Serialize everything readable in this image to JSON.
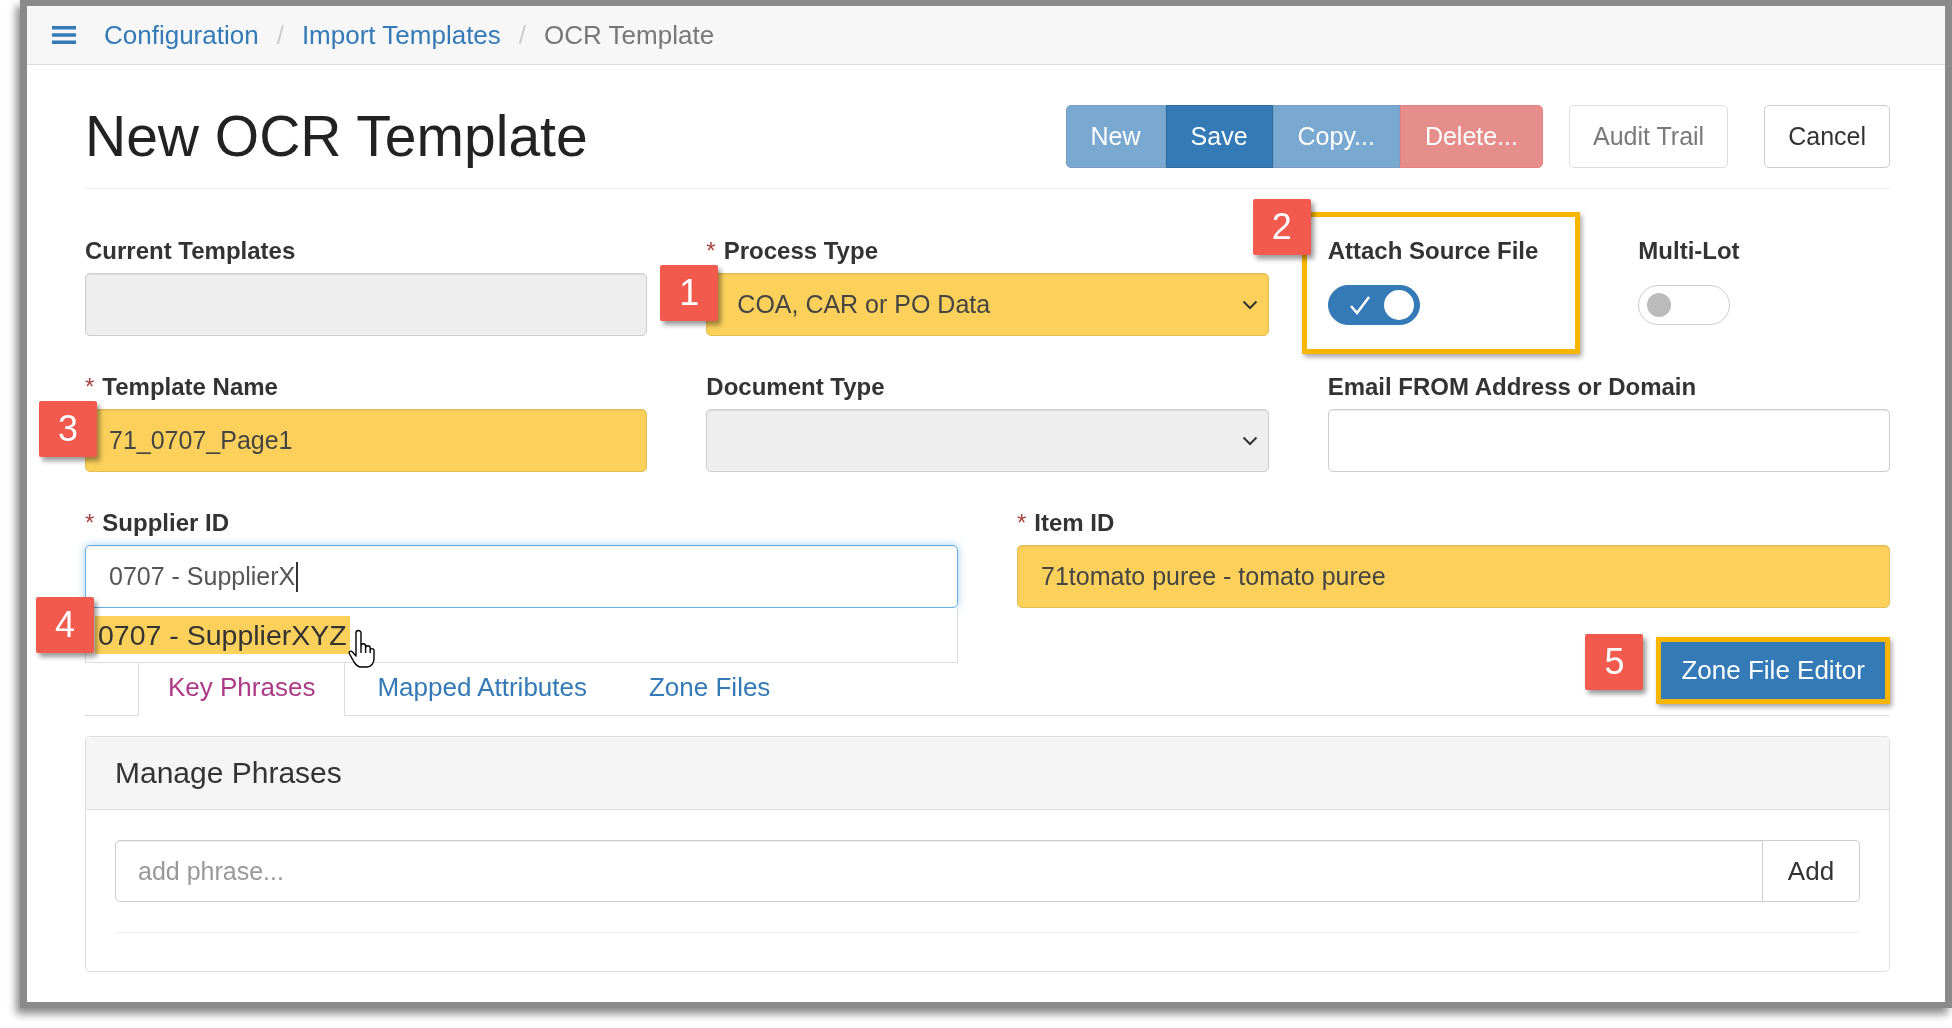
{
  "breadcrumb": {
    "separator": "/",
    "items": [
      {
        "label": "Configuration",
        "current": false
      },
      {
        "label": "Import Templates",
        "current": false
      },
      {
        "label": "OCR Template",
        "current": true
      }
    ]
  },
  "title": "New OCR Template",
  "actions": {
    "group": [
      {
        "label": "New",
        "kind": "primary",
        "disabled": true
      },
      {
        "label": "Save",
        "kind": "primary",
        "disabled": false
      },
      {
        "label": "Copy...",
        "kind": "primary",
        "disabled": true
      },
      {
        "label": "Delete...",
        "kind": "danger",
        "disabled": true
      }
    ],
    "buttons": [
      {
        "label": "Audit Trail",
        "disabled": true
      },
      {
        "label": "Cancel",
        "disabled": false
      }
    ]
  },
  "form": {
    "rows": [
      {
        "fields": [
          {
            "kind": "text",
            "label": "Current Templates",
            "disabled": true,
            "highlighted": false,
            "focused": false
          },
          {
            "kind": "select",
            "label": "Process Type",
            "required_mark": "*",
            "value": "COA, CAR or PO Data",
            "disabled": false,
            "highlighted": true,
            "focused": false,
            "callout": "1"
          },
          {
            "kind": "toggle",
            "label": "Attach Source File",
            "on": true,
            "outlined": true,
            "callout": "2"
          },
          {
            "kind": "toggle",
            "label": "Multi-Lot",
            "on": false,
            "outlined": false
          }
        ]
      },
      {
        "fields": [
          {
            "kind": "text",
            "label": "Template Name",
            "required_mark": "*",
            "value": "71_0707_Page1",
            "disabled": false,
            "highlighted": true,
            "focused": false,
            "callout": "3"
          },
          {
            "kind": "select",
            "label": "Document Type",
            "disabled": true,
            "highlighted": false,
            "focused": false
          },
          {
            "kind": "text",
            "label": "Email FROM Address or Domain",
            "disabled": false,
            "highlighted": false,
            "focused": false
          }
        ]
      },
      {
        "fields": [
          {
            "kind": "autocomplete",
            "label": "Supplier ID",
            "required_mark": "*",
            "value": "0707 - SupplierX",
            "disabled": false,
            "highlighted": false,
            "focused": true,
            "suggestions": [
              {
                "label": "0707 - SupplierXYZ",
                "highlighted": true,
                "hovered": true,
                "callout": "4"
              }
            ]
          },
          {
            "kind": "text",
            "label": "Item ID",
            "required_mark": "*",
            "value": "71tomato puree - tomato puree",
            "disabled": false,
            "highlighted": true,
            "focused": false
          }
        ]
      }
    ]
  },
  "tabs": [
    {
      "label": "Key Phrases",
      "selected": true
    },
    {
      "label": "Mapped Attributes",
      "selected": false
    },
    {
      "label": "Zone Files",
      "selected": false
    }
  ],
  "zone_file_editor": {
    "label": "Zone File Editor",
    "outlined": true,
    "callout": "5"
  },
  "panel": {
    "title": "Manage Phrases",
    "placeholder": "add phrase...",
    "button": "Add"
  }
}
